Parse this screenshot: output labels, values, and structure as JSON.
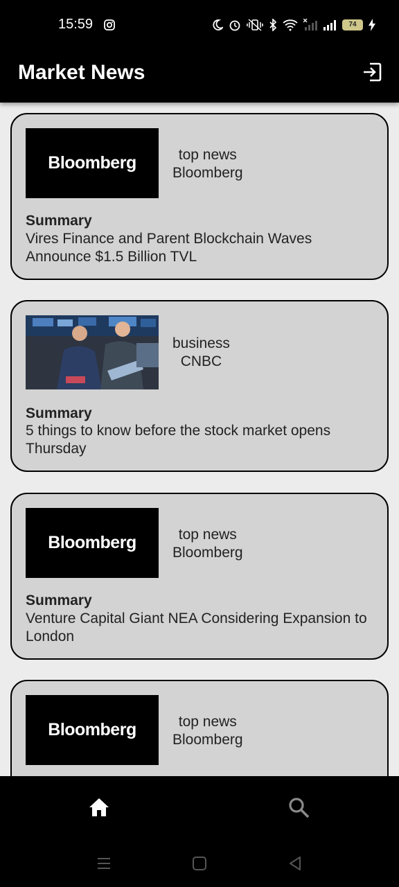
{
  "status_bar": {
    "time": "15:59",
    "battery": "74"
  },
  "app_bar": {
    "title": "Market News"
  },
  "articles": [
    {
      "category": "top news",
      "source": "Bloomberg",
      "logo_text": "Bloomberg",
      "summary_label": "Summary",
      "summary": "Vires Finance and Parent Blockchain Waves Announce $1.5 Billion TVL"
    },
    {
      "category": "business",
      "source": "CNBC",
      "summary_label": "Summary",
      "summary": "5 things to know before the stock market opens Thursday"
    },
    {
      "category": "top news",
      "source": "Bloomberg",
      "logo_text": "Bloomberg",
      "summary_label": "Summary",
      "summary": "Venture Capital Giant NEA Considering Expansion to London"
    },
    {
      "category": "top news",
      "source": "Bloomberg",
      "logo_text": "Bloomberg"
    }
  ],
  "bottom_nav": {
    "items": [
      "home-icon",
      "search-icon"
    ]
  },
  "colors": {
    "card_bg": "#d3d3d3",
    "page_bg": "#ececec",
    "bar_bg": "#000000"
  }
}
